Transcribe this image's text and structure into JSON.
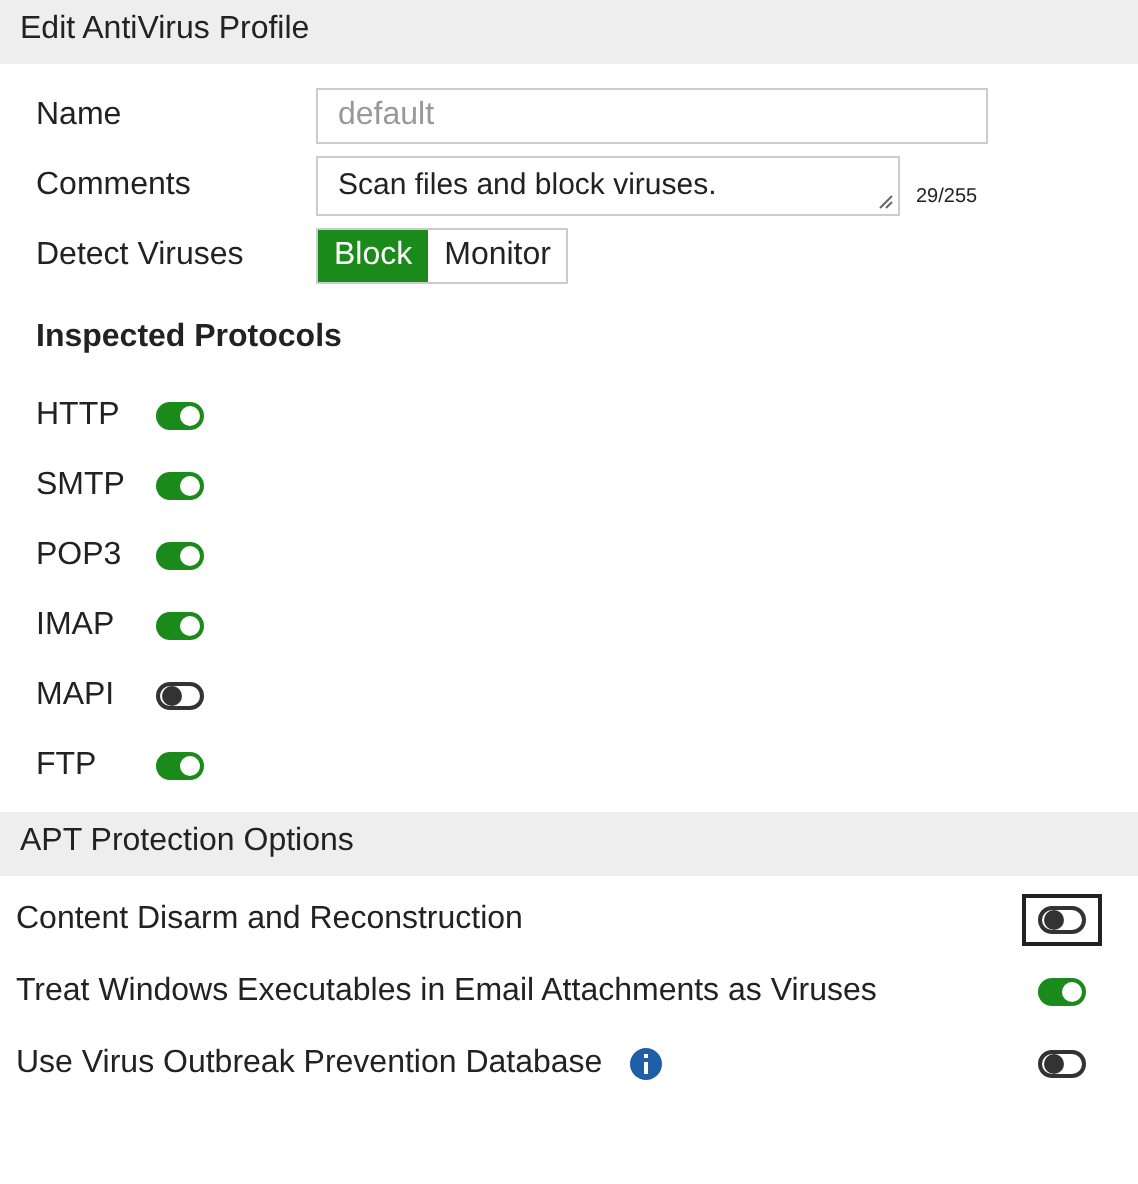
{
  "window": {
    "title": "Edit AntiVirus Profile"
  },
  "name": {
    "label": "Name",
    "placeholder": "default"
  },
  "comments": {
    "label": "Comments",
    "value": "Scan files and block viruses.",
    "count": "29/255"
  },
  "detect_viruses": {
    "label": "Detect Viruses",
    "options": [
      {
        "label": "Block",
        "selected": true
      },
      {
        "label": "Monitor",
        "selected": false
      }
    ]
  },
  "inspected_protocols": {
    "title": "Inspected Protocols",
    "items": [
      {
        "label": "HTTP",
        "on": true
      },
      {
        "label": "SMTP",
        "on": true
      },
      {
        "label": "POP3",
        "on": true
      },
      {
        "label": "IMAP",
        "on": true
      },
      {
        "label": "MAPI",
        "on": false
      },
      {
        "label": "FTP",
        "on": true
      }
    ]
  },
  "apt_protection": {
    "title": "APT Protection Options",
    "items": [
      {
        "label": "Content Disarm and Reconstruction",
        "on": false,
        "focused": true,
        "info": false
      },
      {
        "label": "Treat Windows Executables in Email Attachments as Viruses",
        "on": true,
        "focused": false,
        "info": false
      },
      {
        "label": "Use Virus Outbreak Prevention Database",
        "on": false,
        "focused": false,
        "info": true
      }
    ]
  }
}
